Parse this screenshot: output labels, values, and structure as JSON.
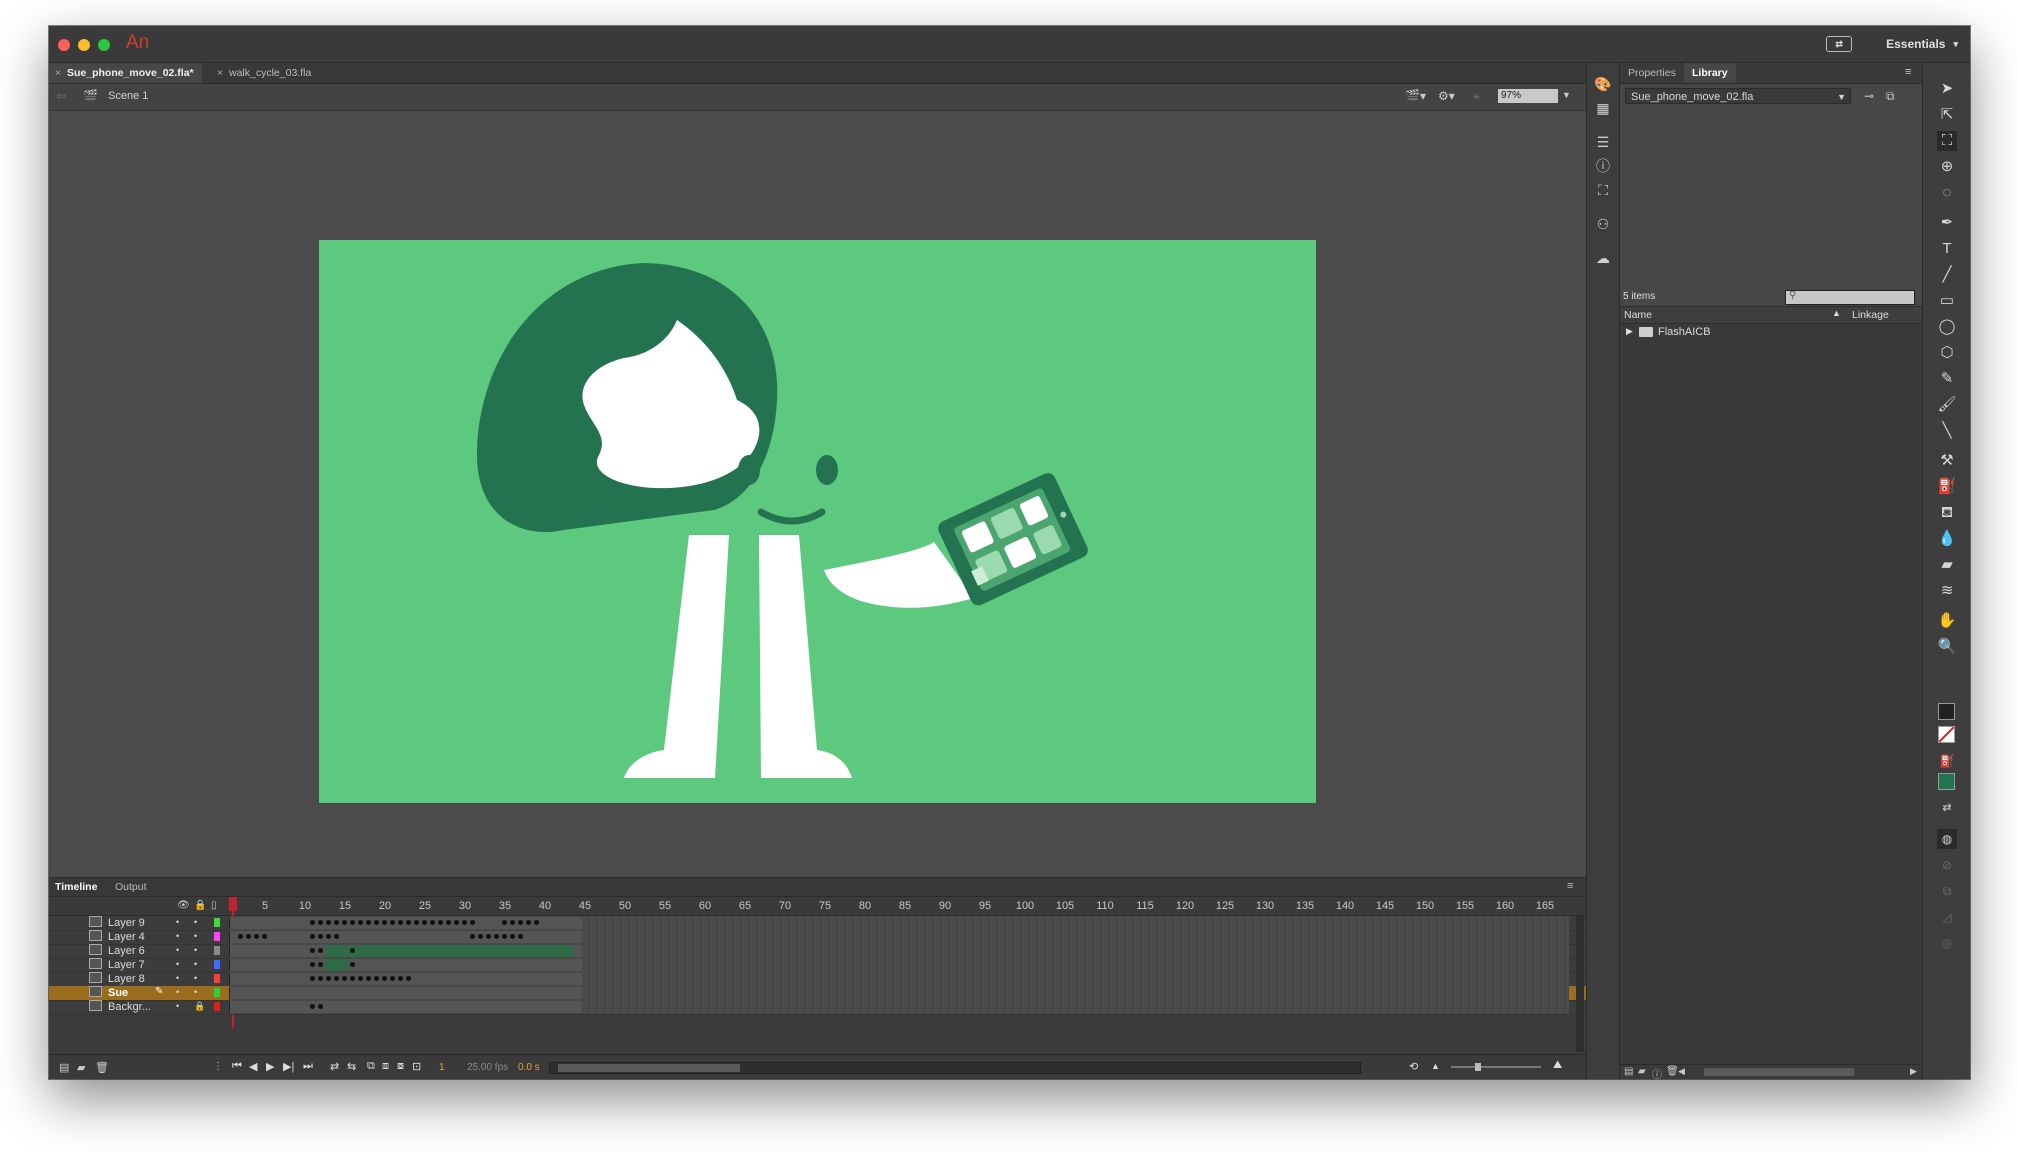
{
  "app": {
    "logo": "An",
    "workspace": "Essentials"
  },
  "tabs": [
    {
      "label": "Sue_phone_move_02.fla*",
      "active": true
    },
    {
      "label": "walk_cycle_03.fla",
      "active": false
    }
  ],
  "editbar": {
    "scene": "Scene 1",
    "zoom": "97%"
  },
  "stage": {
    "background": "#5dc97f",
    "dark": "#247350",
    "light": "#ffffff"
  },
  "timeline": {
    "tabs": [
      "Timeline",
      "Output"
    ],
    "ruler": [
      "1",
      "5",
      "10",
      "15",
      "20",
      "25",
      "30",
      "35",
      "40",
      "45",
      "50",
      "55",
      "60",
      "65",
      "70",
      "75",
      "80",
      "85",
      "90",
      "95",
      "100",
      "105",
      "110",
      "115",
      "120",
      "125",
      "130",
      "135",
      "140",
      "145",
      "150",
      "155",
      "160",
      "165"
    ],
    "layers": [
      {
        "name": "Layer 9",
        "color": "#3ddc3d",
        "selected": false
      },
      {
        "name": "Layer 4",
        "color": "#ff44ff",
        "selected": false
      },
      {
        "name": "Layer 6",
        "color": "#8a8a8a",
        "selected": false
      },
      {
        "name": "Layer 7",
        "color": "#3b6cff",
        "selected": false
      },
      {
        "name": "Layer 8",
        "color": "#ff3a3a",
        "selected": false
      },
      {
        "name": "Sue",
        "color": "#30d13a",
        "selected": true
      },
      {
        "name": "Backgr...",
        "color": "#e02020",
        "selected": false
      }
    ],
    "current_frame": "1",
    "fps": "25.00 fps",
    "time": "0.0 s"
  },
  "panel": {
    "tabs": [
      "Properties",
      "Library"
    ],
    "library_file": "Sue_phone_move_02.fla",
    "items_count": "5 items",
    "col_name": "Name",
    "col_linkage": "Linkage",
    "folder": "FlashAICB"
  }
}
